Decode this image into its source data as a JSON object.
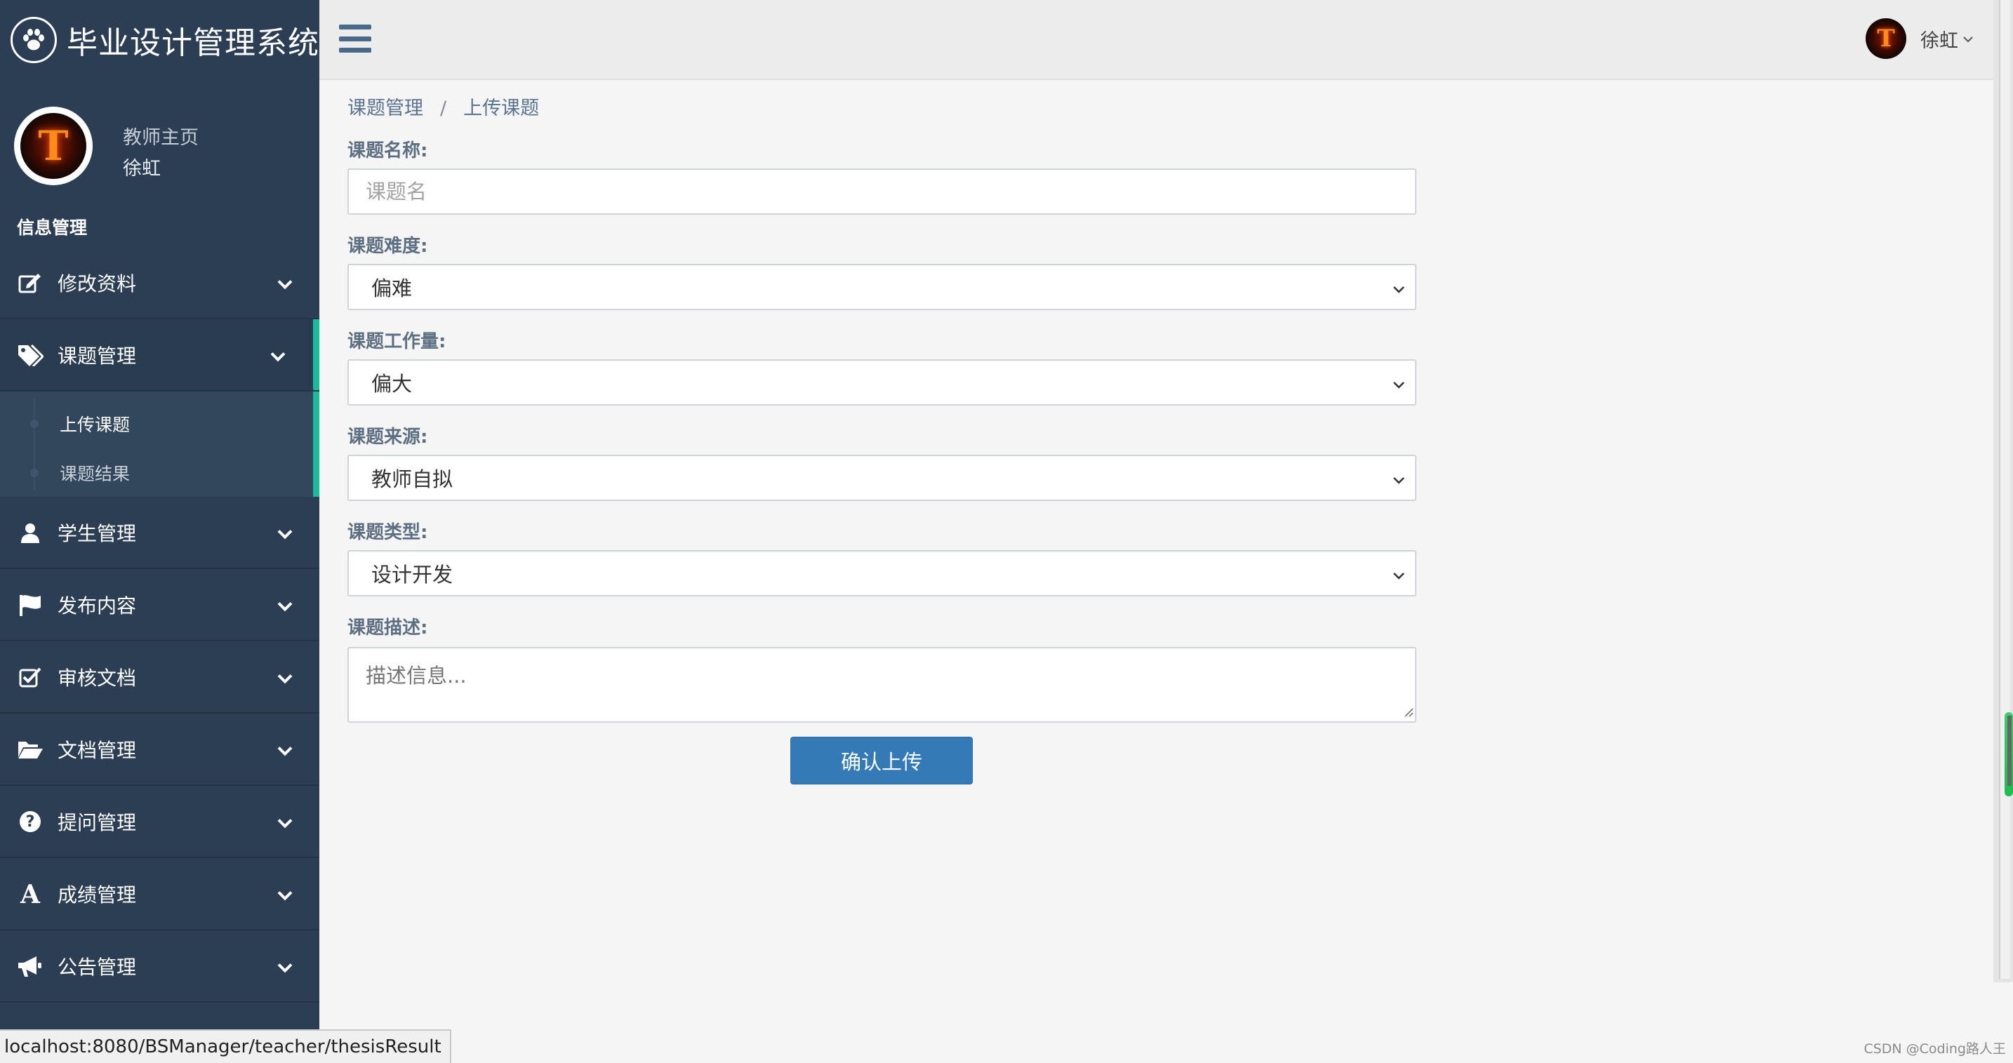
{
  "app": {
    "title": "毕业设计管理系统"
  },
  "profile": {
    "role": "教师主页",
    "name": "徐虹",
    "avatar_letter": "T"
  },
  "sidebar": {
    "section_label": "信息管理",
    "items": [
      {
        "label": "修改资料",
        "icon": "edit-icon"
      },
      {
        "label": "课题管理",
        "icon": "tags-icon"
      },
      {
        "label": "学生管理",
        "icon": "user-icon"
      },
      {
        "label": "发布内容",
        "icon": "flag-icon"
      },
      {
        "label": "审核文档",
        "icon": "check-square-icon"
      },
      {
        "label": "文档管理",
        "icon": "folder-open-icon"
      },
      {
        "label": "提问管理",
        "icon": "question-circle-icon"
      },
      {
        "label": "成绩管理",
        "icon": "font-icon"
      },
      {
        "label": "公告管理",
        "icon": "bullhorn-icon"
      }
    ],
    "submenu": [
      {
        "label": "上传课题"
      },
      {
        "label": "课题结果"
      }
    ],
    "accent_color": "#1abc9c"
  },
  "topbar": {
    "user_name": "徐虹",
    "avatar_letter": "T"
  },
  "breadcrumb": {
    "parent": "课题管理",
    "separator": "/",
    "current": "上传课题"
  },
  "form": {
    "name_label": "课题名称:",
    "name_placeholder": "课题名",
    "difficulty_label": "课题难度:",
    "difficulty_value": "偏难",
    "workload_label": "课题工作量:",
    "workload_value": "偏大",
    "source_label": "课题来源:",
    "source_value": "教师自拟",
    "type_label": "课题类型:",
    "type_value": "设计开发",
    "desc_label": "课题描述:",
    "desc_placeholder": "描述信息...",
    "submit_label": "确认上传",
    "button_color": "#337ab7"
  },
  "statusbar": {
    "url": "localhost:8080/BSManager/teacher/thesisResult"
  },
  "watermark": "CSDN @Coding路人王"
}
